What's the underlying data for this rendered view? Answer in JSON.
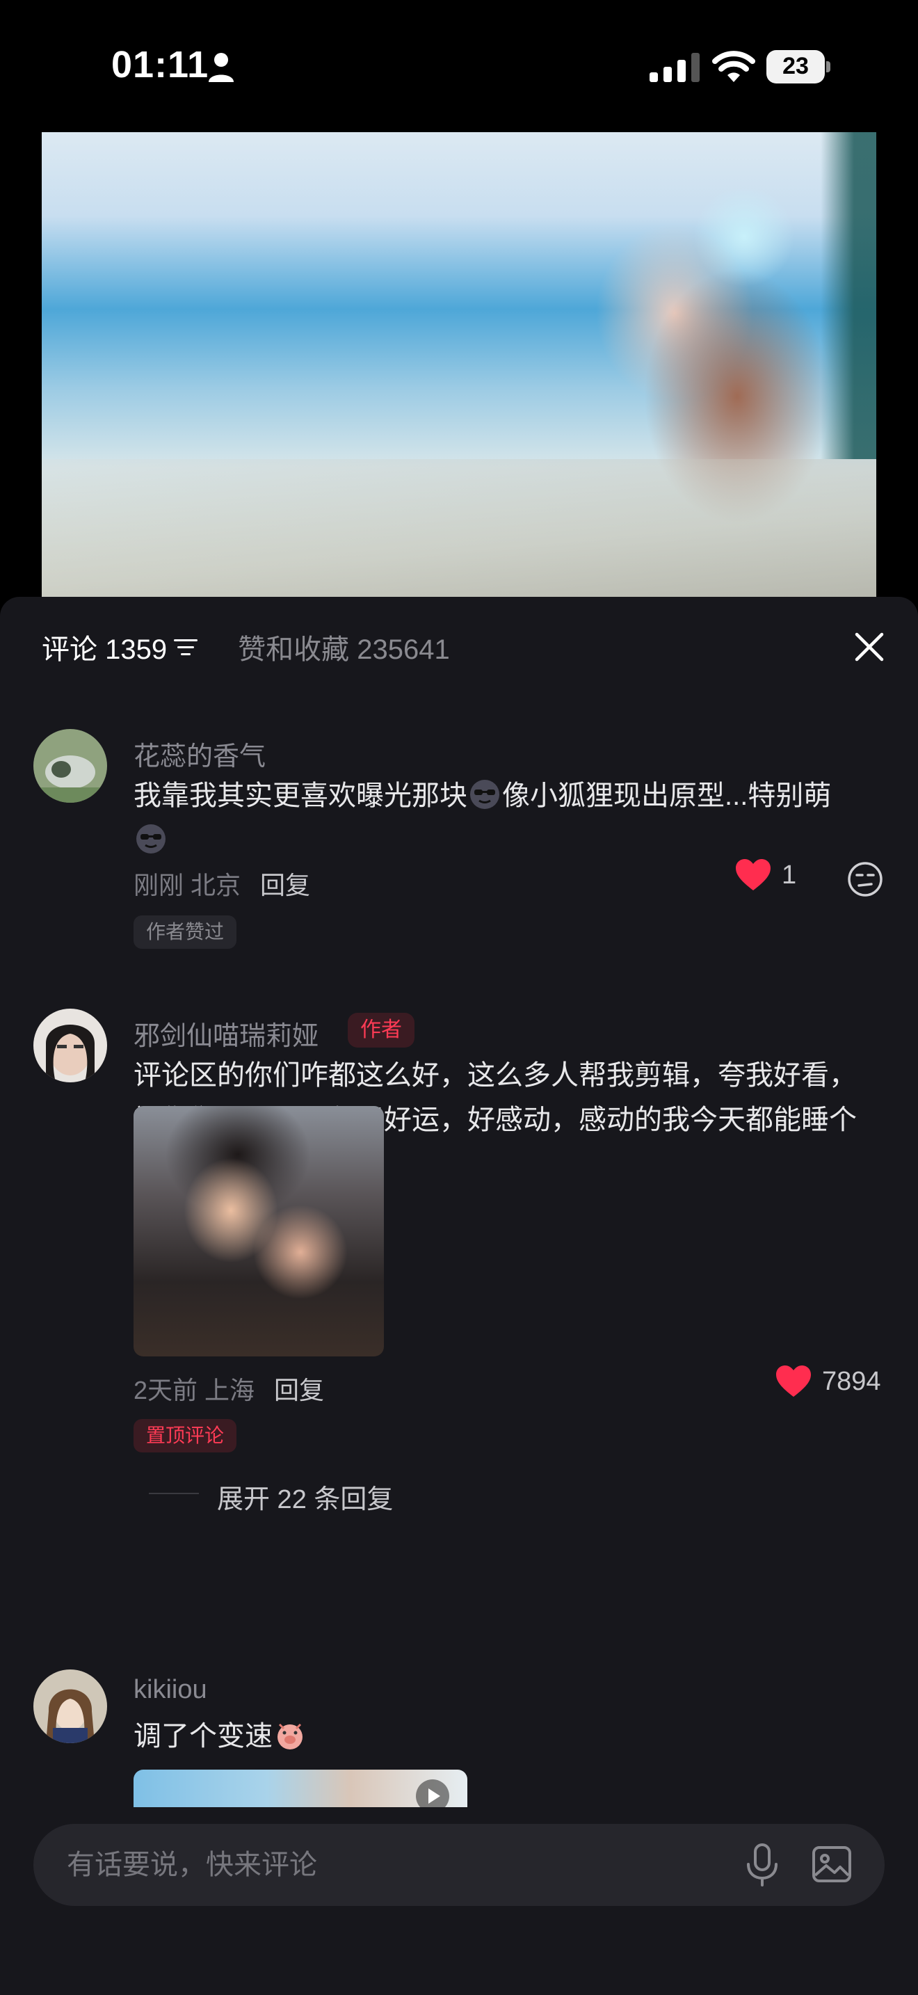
{
  "status_bar": {
    "time": "01:11",
    "battery": "23"
  },
  "panel": {
    "tab_comments": "评论 1359",
    "tab_likes": "赞和收藏 235641"
  },
  "comments": [
    {
      "user": "花蕊的香气",
      "text_a": "我靠我其实更喜欢曝光那块",
      "text_b": "像小狐狸现出原型...特别萌",
      "time": "刚刚 北京",
      "reply": "回复",
      "likes": "1",
      "tag": "作者赞过"
    },
    {
      "user": "邪剑仙喵瑞莉娅",
      "badge": "作者",
      "text": "评论区的你们咋都这么好，这么多人帮我剪辑，夸我好看，祝你们天天开心永远好运，好感动，感动的我今天都能睡个好觉了",
      "time": "2天前 上海",
      "reply": "回复",
      "likes": "7894",
      "tag": "置顶评论",
      "expand": "展开 22 条回复"
    },
    {
      "user": "kikiiou",
      "text": "调了个变速"
    }
  ],
  "input": {
    "placeholder": "有话要说，快来评论"
  },
  "colors": {
    "accent_red": "#ff2d4f",
    "panel_bg": "#17171c"
  }
}
